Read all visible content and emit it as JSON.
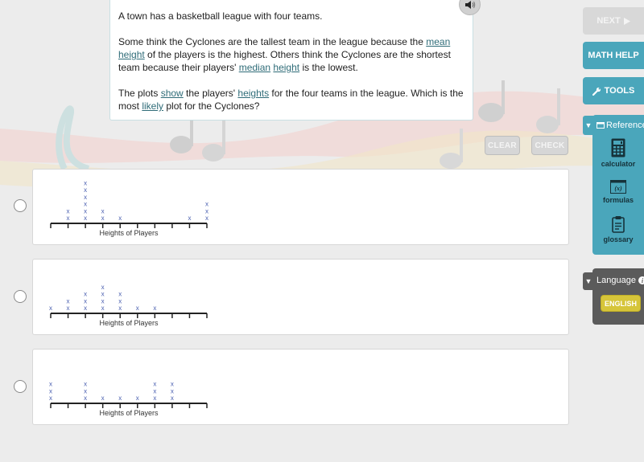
{
  "question": {
    "paragraphs": [
      [
        {
          "t": "A town has a basketball league with four teams."
        }
      ],
      [
        {
          "t": "Some think the Cyclones are the tallest team in the league because the "
        },
        {
          "t": "mean",
          "link": true
        },
        {
          "t": " "
        },
        {
          "t": "height",
          "link": true
        },
        {
          "t": " of the players is the highest. Others think the Cyclones are the shortest team because their players' "
        },
        {
          "t": "median",
          "link": true
        },
        {
          "t": " "
        },
        {
          "t": "height",
          "link": true
        },
        {
          "t": " is the lowest."
        }
      ],
      [
        {
          "t": "The plots "
        },
        {
          "t": "show",
          "link": true
        },
        {
          "t": " the players' "
        },
        {
          "t": "heights",
          "link": true
        },
        {
          "t": " for the four teams in the league. Which is the most "
        },
        {
          "t": "likely",
          "link": true
        },
        {
          "t": " plot for the Cyclones?"
        }
      ]
    ],
    "audio_icon": "speaker-icon"
  },
  "actions": {
    "clear_label": "CLEAR",
    "check_label": "CHECK"
  },
  "sidebar": {
    "next_label": "NEXT",
    "next_icon": "play-arrow-icon",
    "math_help_label": "MATH HELP",
    "tools_label": "TOOLS",
    "tools_icon": "wrench-icon",
    "reference": {
      "title": "Reference",
      "items": [
        {
          "label": "calculator",
          "icon": "calculator-icon"
        },
        {
          "label": "formulas",
          "icon": "formulas-icon"
        },
        {
          "label": "glossary",
          "icon": "glossary-icon"
        }
      ]
    },
    "language": {
      "title": "Language",
      "selected": "ENGLISH"
    }
  },
  "chart_data": [
    {
      "type": "scatter",
      "subtype": "dot-plot",
      "option": 1,
      "xlabel": "Heights of Players",
      "tick_count": 10,
      "tick_labels": [],
      "positions": [
        0,
        1,
        2,
        3,
        4,
        5,
        6,
        7,
        8,
        9
      ],
      "counts": [
        0,
        2,
        6,
        2,
        1,
        0,
        0,
        0,
        1,
        3
      ],
      "marker": "x"
    },
    {
      "type": "scatter",
      "subtype": "dot-plot",
      "option": 2,
      "xlabel": "Heights of Players",
      "tick_count": 10,
      "tick_labels": [],
      "positions": [
        0,
        1,
        2,
        3,
        4,
        5,
        6,
        7,
        8,
        9
      ],
      "counts": [
        1,
        2,
        3,
        4,
        3,
        1,
        1,
        0,
        0,
        0
      ],
      "marker": "x"
    },
    {
      "type": "scatter",
      "subtype": "dot-plot",
      "option": 3,
      "xlabel": "Heights of Players",
      "tick_count": 10,
      "tick_labels": [],
      "positions": [
        0,
        1,
        2,
        3,
        4,
        5,
        6,
        7,
        8,
        9
      ],
      "counts": [
        3,
        0,
        3,
        1,
        1,
        1,
        3,
        3,
        0,
        0
      ],
      "marker": "x"
    }
  ],
  "colors": {
    "accent": "#4aa6bb",
    "language_panel": "#5b5b5b",
    "english_button": "#d6c53a",
    "marker": "#4a5fb0",
    "link": "#2f6c78"
  }
}
